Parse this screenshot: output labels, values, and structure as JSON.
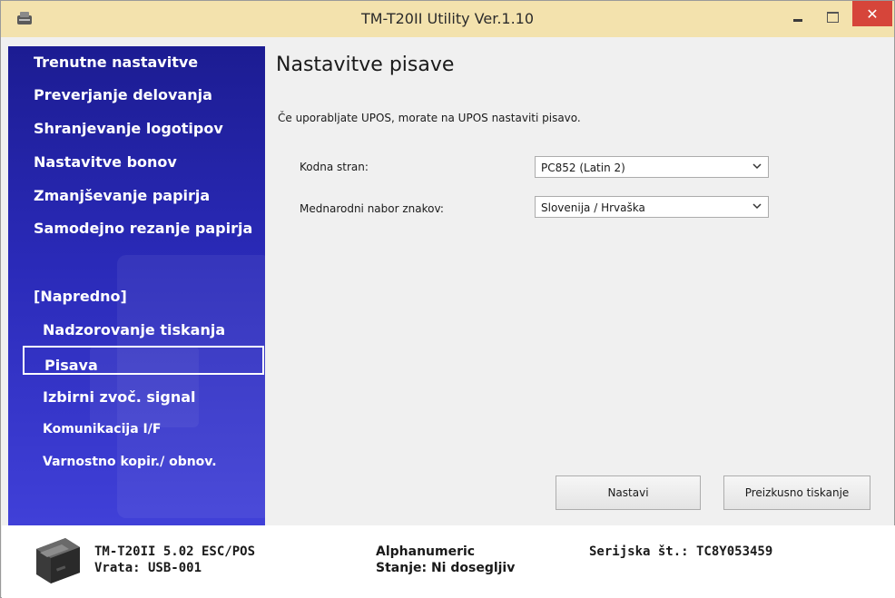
{
  "window": {
    "title": "TM-T20II Utility Ver.1.10",
    "close_glyph": "✕"
  },
  "sidebar": {
    "items": [
      {
        "label": "Trenutne nastavitve"
      },
      {
        "label": "Preverjanje delovanja"
      },
      {
        "label": "Shranjevanje logotipov"
      },
      {
        "label": "Nastavitve bonov"
      },
      {
        "label": "Zmanjševanje papirja"
      },
      {
        "label": "Samodejno rezanje papirja"
      }
    ],
    "advanced_header": "[Napredno]",
    "advanced_items": [
      {
        "label": "Nadzorovanje tiskanja"
      },
      {
        "label": "Pisava",
        "selected": true
      },
      {
        "label": "Izbirni zvoč. signal"
      },
      {
        "label": "Komunikacija I/F"
      },
      {
        "label": "Varnostno kopir./ obnov."
      }
    ]
  },
  "main": {
    "title": "Nastavitve pisave",
    "info": "Če uporabljate UPOS, morate na UPOS nastaviti pisavo.",
    "code_page": {
      "label": "Kodna stran:",
      "value": "PC852 (Latin 2)"
    },
    "charset": {
      "label": "Mednarodni nabor znakov:",
      "value": "Slovenija / Hrvaška"
    },
    "buttons": {
      "apply": "Nastavi",
      "test_print": "Preizkusno tiskanje"
    }
  },
  "footer": {
    "model": "TM-T20II 5.02 ESC/POS",
    "port": "Vrata: USB-001",
    "mode": "Alphanumeric",
    "status": "Stanje: Ni dosegljiv",
    "serial": "Serijska št.: TC8Y053459"
  },
  "colors": {
    "sidebar": "#2a2ab8",
    "titlebar": "#f3e2ad",
    "close": "#d6453a"
  }
}
